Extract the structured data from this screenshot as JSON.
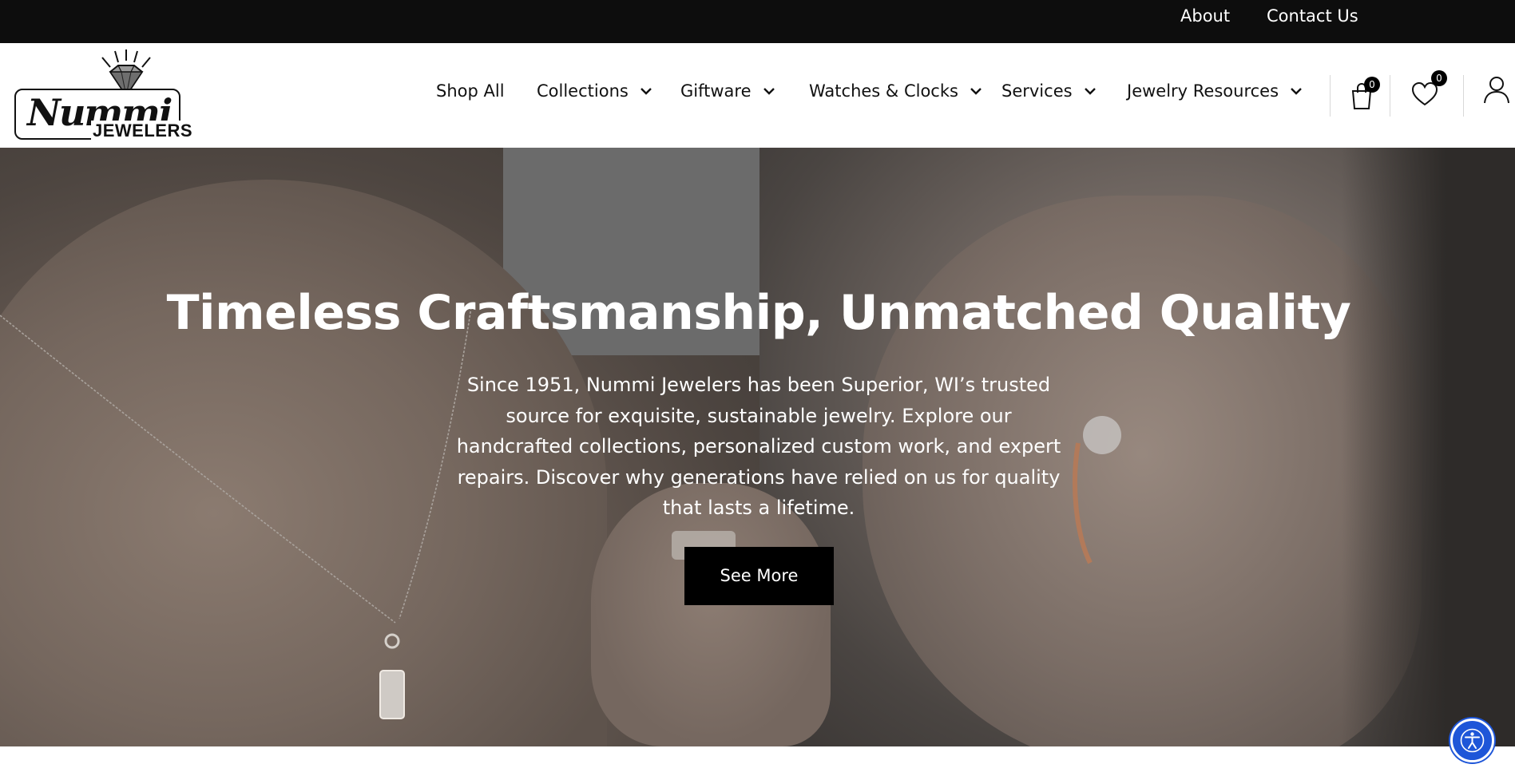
{
  "topbar": {
    "about": "About",
    "contact": "Contact Us"
  },
  "logo": {
    "script_text": "Nummi",
    "sub_text": "JEWELERS",
    "icon": "diamond-icon"
  },
  "nav": {
    "items": [
      {
        "label": "Shop All",
        "has_dropdown": false
      },
      {
        "label": "Collections",
        "has_dropdown": true
      },
      {
        "label": "Giftware",
        "has_dropdown": true
      },
      {
        "label": "Watches & Clocks",
        "has_dropdown": true
      },
      {
        "label": "Services",
        "has_dropdown": true
      },
      {
        "label": "Jewelry Resources",
        "has_dropdown": true
      }
    ]
  },
  "header_icons": {
    "cart": {
      "icon": "shopping-bag-icon",
      "count": "0"
    },
    "wishlist": {
      "icon": "heart-icon",
      "count": "0"
    },
    "account": {
      "icon": "user-icon"
    }
  },
  "hero": {
    "title": "Timeless Craftsmanship, Unmatched Quality",
    "description": "Since 1951, Nummi Jewelers has been Superior, WI’s trusted source for exquisite, sustainable jewelry. Explore our handcrafted collections, personalized custom work, and expert repairs. Discover why generations have relied on us for quality that lasts a lifetime.",
    "button_label": "See More"
  },
  "accessibility": {
    "icon": "accessibility-icon"
  },
  "colors": {
    "topbar_bg": "#0d0d0d",
    "button_bg": "#000000",
    "accessibility_blue": "#1e56d8"
  }
}
